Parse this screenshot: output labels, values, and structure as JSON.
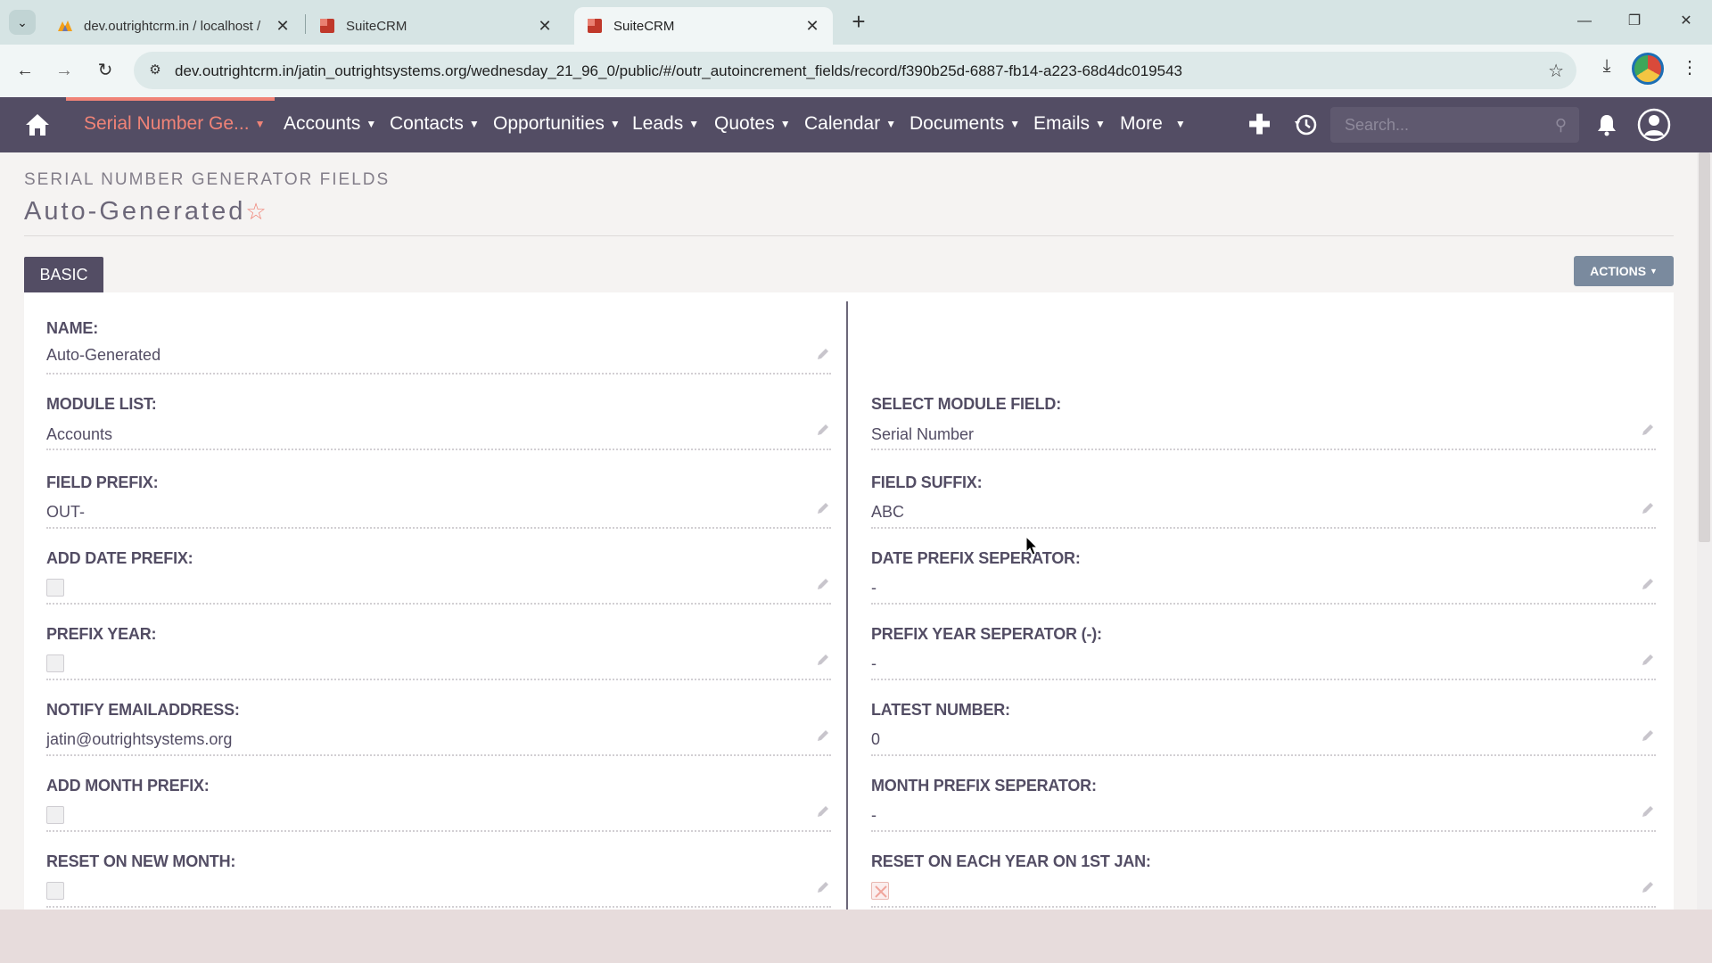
{
  "browser": {
    "tabs": [
      {
        "title": "dev.outrightcrm.in / localhost /",
        "active": false
      },
      {
        "title": "SuiteCRM",
        "active": false
      },
      {
        "title": "SuiteCRM",
        "active": true
      }
    ],
    "url": "dev.outrightcrm.in/jatin_outrightsystems.org/wednesday_21_96_0/public/#/outr_autoincrement_fields/record/f390b25d-6887-fb14-a223-68d4dc019543"
  },
  "nav": {
    "items": [
      {
        "label": "Serial Number Ge...",
        "active": true
      },
      {
        "label": "Accounts"
      },
      {
        "label": "Contacts"
      },
      {
        "label": "Opportunities"
      },
      {
        "label": "Leads"
      },
      {
        "label": "Quotes"
      },
      {
        "label": "Calendar"
      },
      {
        "label": "Documents"
      },
      {
        "label": "Emails"
      },
      {
        "label": "More"
      }
    ],
    "search_placeholder": "Search..."
  },
  "page": {
    "module_title": "SERIAL NUMBER GENERATOR FIELDS",
    "record_title": "Auto-Generated",
    "tab_label": "BASIC",
    "actions_label": "ACTIONS"
  },
  "fields": {
    "name": {
      "label": "NAME:",
      "value": "Auto-Generated"
    },
    "module_list": {
      "label": "MODULE LIST:",
      "value": "Accounts"
    },
    "select_module_field": {
      "label": "SELECT MODULE FIELD:",
      "value": "Serial Number"
    },
    "field_prefix": {
      "label": "FIELD PREFIX:",
      "value": "OUT-"
    },
    "field_suffix": {
      "label": "FIELD SUFFIX:",
      "value": "ABC"
    },
    "add_date_prefix": {
      "label": "ADD DATE PREFIX:",
      "checked": false
    },
    "date_prefix_seperator": {
      "label": "DATE PREFIX SEPERATOR:",
      "value": "-"
    },
    "prefix_year": {
      "label": "PREFIX YEAR:",
      "checked": false
    },
    "prefix_year_seperator": {
      "label": "PREFIX YEAR SEPERATOR (-):",
      "value": "-"
    },
    "notify_emailaddress": {
      "label": "NOTIFY EMAILADDRESS:",
      "value": "jatin@outrightsystems.org"
    },
    "latest_number": {
      "label": "LATEST NUMBER:",
      "value": "0"
    },
    "add_month_prefix": {
      "label": "ADD MONTH PREFIX:",
      "checked": false
    },
    "month_prefix_seperator": {
      "label": "MONTH PREFIX SEPERATOR:",
      "value": "-"
    },
    "reset_on_new_month": {
      "label": "RESET ON NEW MONTH:",
      "checked": false
    },
    "reset_on_each_year": {
      "label": "RESET ON EACH YEAR ON 1ST JAN:",
      "checked": true
    }
  },
  "colors": {
    "nav_bg": "#534d64",
    "accent": "#f08377",
    "actions_btn": "#7a8a9e"
  }
}
